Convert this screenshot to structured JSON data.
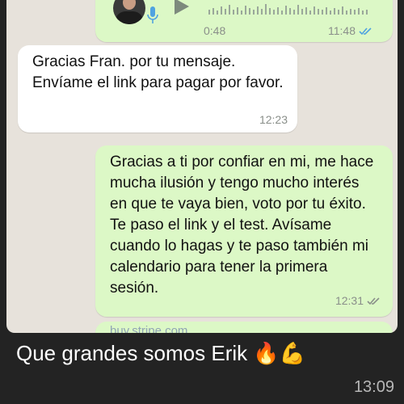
{
  "voice_message": {
    "duration": "0:48",
    "time": "11:48",
    "icons": [
      "avatar",
      "mic-icon",
      "play-icon",
      "double-check-icon"
    ]
  },
  "messages": [
    {
      "direction": "incoming",
      "text": "Gracias Fran.  por tu mensaje. Envíame el link para pagar por favor.",
      "time": "12:23"
    },
    {
      "direction": "outgoing",
      "text": "Gracias a ti por confiar en mi, me hace mucha ilusión y tengo mucho interés en que te vaya bien, voto por tu éxito. Te paso el link y el test. Avísame cuando lo hagas y te paso también mi calendario para tener la primera sesión.",
      "time": "12:31"
    }
  ],
  "link_preview": {
    "text": "buy.stripe.com"
  },
  "caption": {
    "text": "Que grandes somos Erik",
    "emojis": "🔥💪",
    "time": "13:09"
  },
  "colors": {
    "chat_background": "#e7e2db",
    "outgoing_bubble": "#dcf8c6",
    "incoming_bubble": "#ffffff",
    "read_ticks": "#4fa3e0",
    "caption_background": "#232323"
  }
}
